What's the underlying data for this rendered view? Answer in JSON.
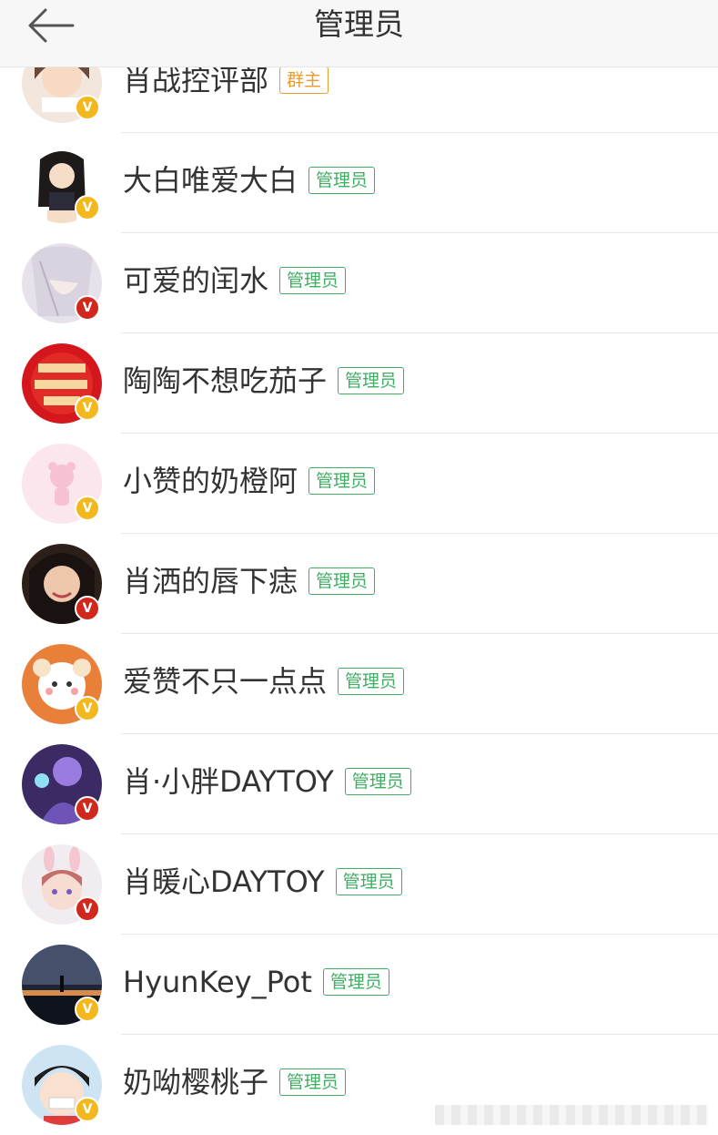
{
  "header": {
    "title": "管理员",
    "back_icon": "arrow-left-icon"
  },
  "colors": {
    "admin_tag": "#3fae63",
    "owner_tag": "#ec9c2b",
    "badge_red": "#d0281c",
    "badge_gold": "#f2b81e"
  },
  "members": [
    {
      "name": "肖战控评部",
      "tag": "群主",
      "badge": "V",
      "badge_color": "gold"
    },
    {
      "name": "大白唯爱大白",
      "tag": "管理员",
      "badge": "V",
      "badge_color": "gold"
    },
    {
      "name": "可爱的闰水",
      "tag": "管理员",
      "badge": "V",
      "badge_color": "red"
    },
    {
      "name": "陶陶不想吃茄子",
      "tag": "管理员",
      "badge": "V",
      "badge_color": "gold"
    },
    {
      "name": "小赞的奶橙阿",
      "tag": "管理员",
      "badge": "V",
      "badge_color": "gold"
    },
    {
      "name": "肖洒的唇下痣",
      "tag": "管理员",
      "badge": "V",
      "badge_color": "red"
    },
    {
      "name": "爱赞不只一点点",
      "tag": "管理员",
      "badge": "V",
      "badge_color": "gold"
    },
    {
      "name": "肖·小胖DAYTOY",
      "tag": "管理员",
      "badge": "V",
      "badge_color": "red"
    },
    {
      "name": "肖暖心DAYTOY",
      "tag": "管理员",
      "badge": "V",
      "badge_color": "red"
    },
    {
      "name": "HyunKey_Pot",
      "tag": "管理员",
      "badge": "V",
      "badge_color": "gold"
    },
    {
      "name": "奶呦樱桃子",
      "tag": "管理员",
      "badge": "V",
      "badge_color": "gold"
    }
  ]
}
